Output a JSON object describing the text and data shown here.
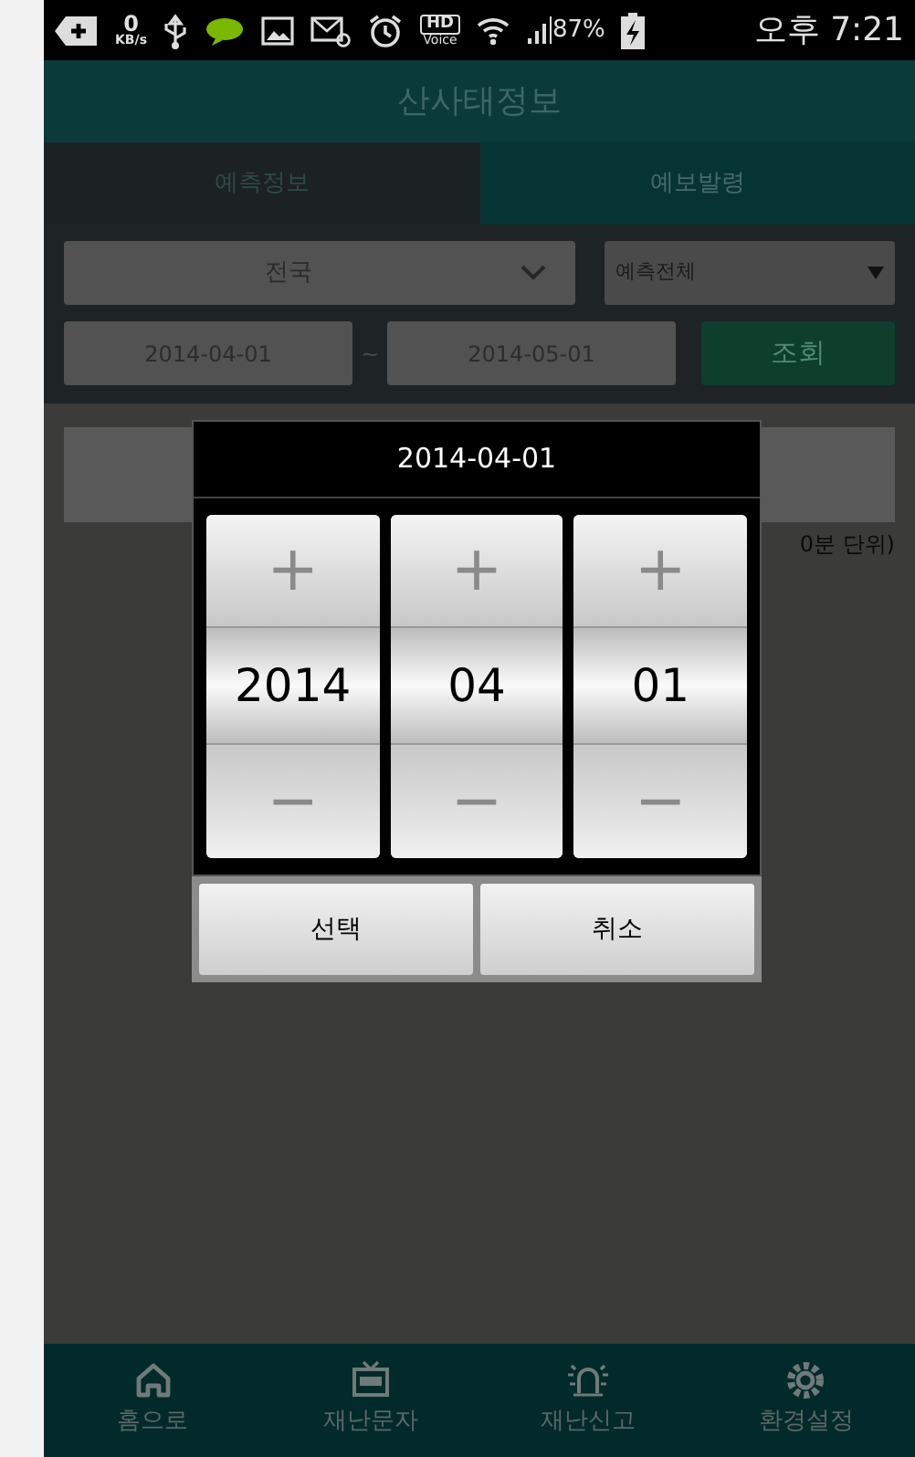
{
  "status_bar": {
    "speed_value": "0",
    "speed_unit": "KB/s",
    "hd_top": "HD",
    "hd_bottom": "Voice",
    "battery": "87%",
    "time": "오후 7:21"
  },
  "title": "산사태정보",
  "tabs": [
    {
      "label": "예측정보",
      "selected": true
    },
    {
      "label": "예보발령",
      "selected": false
    }
  ],
  "filters": {
    "region": "전국",
    "type_placeholder": "예측전체",
    "start_date": "2014-04-01",
    "separator": "~",
    "end_date": "2014-05-01",
    "search_button": "조회"
  },
  "content": {
    "note": "0분 단위)"
  },
  "date_dialog": {
    "title": "2014-04-01",
    "columns": [
      {
        "plus": "+",
        "value": "2014",
        "minus": "−"
      },
      {
        "plus": "+",
        "value": "04",
        "minus": "−"
      },
      {
        "plus": "+",
        "value": "01",
        "minus": "−"
      }
    ],
    "buttons": [
      "선택",
      "취소"
    ]
  },
  "bottom_nav": [
    {
      "kind": "home",
      "label": "홈으로"
    },
    {
      "kind": "tv",
      "label": "재난문자"
    },
    {
      "kind": "siren",
      "label": "재난신고"
    },
    {
      "kind": "gear",
      "label": "환경설정"
    }
  ]
}
